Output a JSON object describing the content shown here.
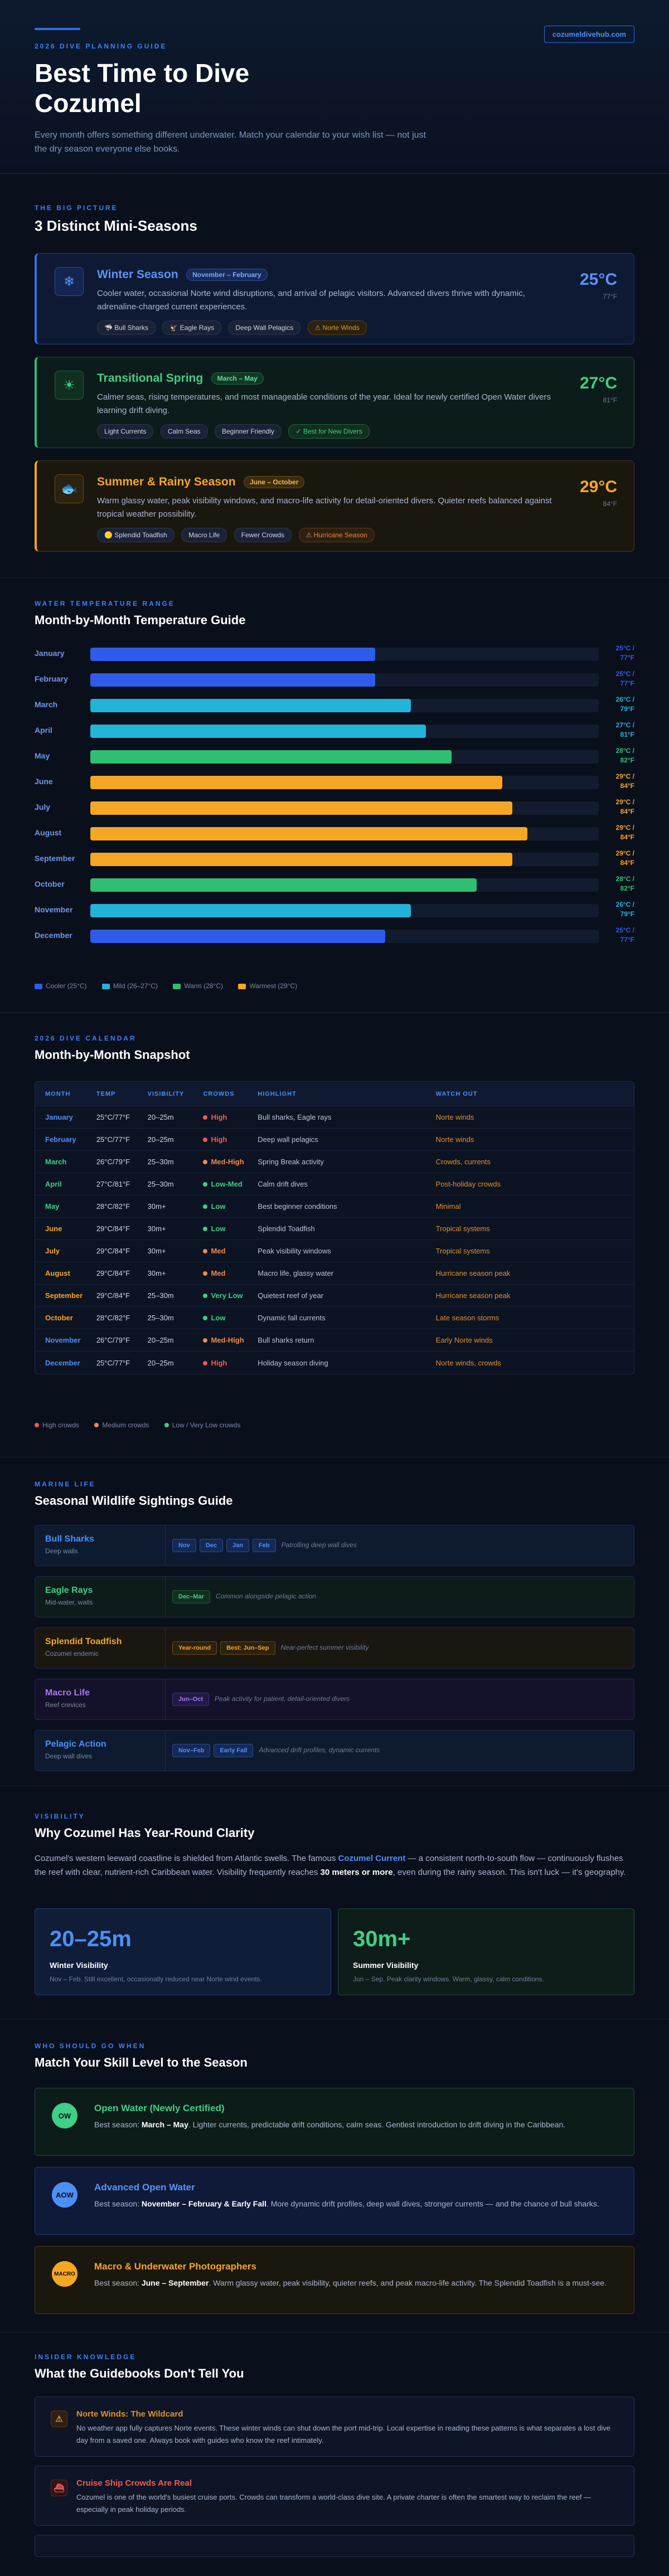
{
  "site": "cozumeldivehub.com",
  "hero": {
    "kicker": "2026 Dive Planning Guide",
    "title_line1": "Best Time to Dive",
    "title_line2": "Cozumel",
    "subtitle": "Every month offers something different underwater. Match your calendar to your wish list — not just the dry season everyone else books."
  },
  "seasons_section": {
    "kicker": "The Big Picture",
    "title": "3 Distinct Mini-Seasons",
    "items": [
      {
        "name": "Winter Season",
        "range": "November – February",
        "desc": "Cooler water, occasional Norte wind disruptions, and arrival of pelagic visitors. Advanced divers thrive with dynamic, adrenaline-charged current experiences.",
        "tags": [
          "🦈 Bull Sharks",
          "🦅 Eagle Rays",
          "Deep Wall Pelagics"
        ],
        "flag": "⚠ Norte Winds",
        "temp_c": "25°C",
        "temp_f": "77°F",
        "icon": "snowflake-icon"
      },
      {
        "name": "Transitional Spring",
        "range": "March – May",
        "desc": "Calmer seas, rising temperatures, and most manageable conditions of the year. Ideal for newly certified Open Water divers learning drift diving.",
        "tags": [
          "Light Currents",
          "Calm Seas",
          "Beginner Friendly"
        ],
        "flag": "✓ Best for New Divers",
        "temp_c": "27°C",
        "temp_f": "81°F",
        "icon": "sun-icon"
      },
      {
        "name": "Summer & Rainy Season",
        "range": "June – October",
        "desc": "Warm glassy water, peak visibility windows, and macro-life activity for detail-oriented divers. Quieter reefs balanced against tropical weather possibility.",
        "tags": [
          "🟡 Splendid Toadfish",
          "Macro Life",
          "Fewer Crowds"
        ],
        "flag": "⚠ Hurricane Season",
        "temp_c": "29°C",
        "temp_f": "84°F",
        "icon": "fish-icon"
      }
    ]
  },
  "temps_section": {
    "kicker": "Water Temperature Range",
    "title": "Month-by-Month Temperature Guide",
    "legend": [
      "Cooler (25°C)",
      "Mild (26–27°C)",
      "Warm (28°C)",
      "Warmest (29°C)"
    ],
    "legend_colors": [
      "#2f5bea",
      "#22b4d8",
      "#2fbf71",
      "#f5a623"
    ]
  },
  "chart_data": {
    "type": "bar",
    "title": "Month-by-Month Temperature Guide",
    "categories": [
      "January",
      "February",
      "March",
      "April",
      "May",
      "June",
      "July",
      "August",
      "September",
      "October",
      "November",
      "December"
    ],
    "values": [
      25,
      25,
      26,
      27,
      28,
      29,
      29,
      29,
      29,
      28,
      26,
      25
    ],
    "values_f": [
      77,
      77,
      79,
      81,
      82,
      84,
      84,
      84,
      84,
      82,
      79,
      77
    ],
    "labels_c": [
      "25°C /",
      "25°C /",
      "26°C /",
      "27°C /",
      "28°C /",
      "29°C /",
      "29°C /",
      "29°C /",
      "29°C /",
      "28°C /",
      "26°C /",
      "25°C /"
    ],
    "labels_f": [
      "77°F",
      "77°F",
      "79°F",
      "81°F",
      "82°F",
      "84°F",
      "84°F",
      "84°F",
      "84°F",
      "82°F",
      "79°F",
      "77°F"
    ],
    "bar_fraction": [
      0.56,
      0.56,
      0.63,
      0.66,
      0.71,
      0.81,
      0.83,
      0.86,
      0.83,
      0.76,
      0.63,
      0.58
    ],
    "colors": [
      "#2f5bea",
      "#2f5bea",
      "#22b4d8",
      "#22b4d8",
      "#2fbf71",
      "#f5a623",
      "#f5a623",
      "#f5a623",
      "#f5a623",
      "#2fbf71",
      "#22b4d8",
      "#2f5bea"
    ],
    "unit": "°C"
  },
  "calendar": {
    "kicker": "2026 Dive Calendar",
    "title": "Month-by-Month Snapshot",
    "headers": [
      "MONTH",
      "TEMP",
      "VISIBILITY",
      "CROWDS",
      "HIGHLIGHT",
      "WATCH OUT"
    ],
    "rows": [
      {
        "month": "January",
        "temp": "25°C/77°F",
        "vis": "20–25m",
        "crowds": "High",
        "highlight": "Bull sharks, Eagle rays",
        "watch": "Norte winds",
        "mcolor": "#4d8ff5",
        "ccolor": "#ef5a5a",
        "wcolor": "#e0902f"
      },
      {
        "month": "February",
        "temp": "25°C/77°F",
        "vis": "20–25m",
        "crowds": "High",
        "highlight": "Deep wall pelagics",
        "watch": "Norte winds",
        "mcolor": "#4d8ff5",
        "ccolor": "#ef5a5a",
        "wcolor": "#e0902f"
      },
      {
        "month": "March",
        "temp": "26°C/79°F",
        "vis": "25–30m",
        "crowds": "Med-High",
        "highlight": "Spring Break activity",
        "watch": "Crowds, currents",
        "mcolor": "#3fcf86",
        "ccolor": "#f08a4b",
        "wcolor": "#e0902f"
      },
      {
        "month": "April",
        "temp": "27°C/81°F",
        "vis": "25–30m",
        "crowds": "Low-Med",
        "highlight": "Calm drift dives",
        "watch": "Post-holiday crowds",
        "mcolor": "#3fcf86",
        "ccolor": "#3fcf86",
        "wcolor": "#e0902f"
      },
      {
        "month": "May",
        "temp": "28°C/82°F",
        "vis": "30m+",
        "crowds": "Low",
        "highlight": "Best beginner conditions",
        "watch": "Minimal",
        "mcolor": "#3fcf86",
        "ccolor": "#3fcf86",
        "wcolor": "#e0902f"
      },
      {
        "month": "June",
        "temp": "29°C/84°F",
        "vis": "30m+",
        "crowds": "Low",
        "highlight": "Splendid Toadfish",
        "watch": "Tropical systems",
        "mcolor": "#f5a623",
        "ccolor": "#3fcf86",
        "wcolor": "#e0902f"
      },
      {
        "month": "July",
        "temp": "29°C/84°F",
        "vis": "30m+",
        "crowds": "Med",
        "highlight": "Peak visibility windows",
        "watch": "Tropical systems",
        "mcolor": "#f5a623",
        "ccolor": "#f08a4b",
        "wcolor": "#e0902f"
      },
      {
        "month": "August",
        "temp": "29°C/84°F",
        "vis": "30m+",
        "crowds": "Med",
        "highlight": "Macro life, glassy water",
        "watch": "Hurricane season peak",
        "mcolor": "#f5a623",
        "ccolor": "#f08a4b",
        "wcolor": "#e0902f"
      },
      {
        "month": "September",
        "temp": "29°C/84°F",
        "vis": "25–30m",
        "crowds": "Very Low",
        "highlight": "Quietest reef of year",
        "watch": "Hurricane season peak",
        "mcolor": "#f5a623",
        "ccolor": "#3fcf86",
        "wcolor": "#e0902f"
      },
      {
        "month": "October",
        "temp": "28°C/82°F",
        "vis": "25–30m",
        "crowds": "Low",
        "highlight": "Dynamic fall currents",
        "watch": "Late season storms",
        "mcolor": "#f5a623",
        "ccolor": "#3fcf86",
        "wcolor": "#e0902f"
      },
      {
        "month": "November",
        "temp": "26°C/79°F",
        "vis": "20–25m",
        "crowds": "Med-High",
        "highlight": "Bull sharks return",
        "watch": "Early Norte winds",
        "mcolor": "#4d8ff5",
        "ccolor": "#f08a4b",
        "wcolor": "#e0902f"
      },
      {
        "month": "December",
        "temp": "25°C/77°F",
        "vis": "20–25m",
        "crowds": "High",
        "highlight": "Holiday season diving",
        "watch": "Norte winds, crowds",
        "mcolor": "#4d8ff5",
        "ccolor": "#ef5a5a",
        "wcolor": "#e0902f"
      }
    ],
    "legend": [
      "High crowds",
      "Medium crowds",
      "Low / Very Low crowds"
    ],
    "legend_colors": [
      "#ef5a5a",
      "#f08a4b",
      "#3fcf86"
    ]
  },
  "wildlife": {
    "kicker": "Marine Life",
    "title": "Seasonal Wildlife Sightings Guide",
    "items": [
      {
        "name": "Bull Sharks",
        "sub": "Deep walls",
        "months": [
          "Nov",
          "Dec",
          "Jan",
          "Feb"
        ],
        "note": "Patrolling deep wall dives",
        "color": "#4d8ff5",
        "bg": "#0e1a30",
        "mbg": "#142a55",
        "mborder": "#2a4a8a"
      },
      {
        "name": "Eagle Rays",
        "sub": "Mid-water, walls",
        "months": [
          "Dec–Mar"
        ],
        "note": "Common alongside pelagic action",
        "color": "#3fcf86",
        "bg": "#0d1b1a",
        "mbg": "#12301f",
        "mborder": "#1f5a36"
      },
      {
        "name": "Splendid Toadfish",
        "sub": "Cozumel endemic",
        "months": [
          "Year-round",
          "Best: Jun–Sep"
        ],
        "note": "Near-perfect summer visibility",
        "color": "#f5a623",
        "bg": "#1a1710",
        "mbg": "#2b220f",
        "mborder": "#6a4c13"
      },
      {
        "name": "Macro Life",
        "sub": "Reef crevices",
        "months": [
          "Jun–Oct"
        ],
        "note": "Peak activity for patient, detail-oriented divers",
        "color": "#a878f0",
        "bg": "#14122a",
        "mbg": "#221a45",
        "mborder": "#41317a"
      },
      {
        "name": "Pelagic Action",
        "sub": "Deep wall dives",
        "months": [
          "Nov–Feb",
          "Early Fall"
        ],
        "note": "Advanced drift profiles, dynamic currents",
        "color": "#4d8ff5",
        "bg": "#0e1a30",
        "mbg": "#142a55",
        "mborder": "#2a4a8a"
      }
    ]
  },
  "visibility": {
    "kicker": "Visibility",
    "title": "Why Cozumel Has Year-Round Clarity",
    "p1": "Cozumel's western leeward coastline is shielded from Atlantic swells. The famous",
    "p_link": "Cozumel Current",
    "p2": "— a consistent north-to-south flow — continuously flushes the reef with clear, nutrient-rich Caribbean water. Visibility frequently reaches",
    "p_bold": "30 meters or more",
    "p3": ", even during the rainy season. This isn't luck — it's geography.",
    "cards": [
      {
        "big": "20–25m",
        "title": "Winter Visibility",
        "sub": "Nov – Feb. Still excellent, occasionally reduced near Norte wind events."
      },
      {
        "big": "30m+",
        "title": "Summer Visibility",
        "sub": "Jun – Sep. Peak clarity windows. Warm, glassy, calm conditions."
      }
    ]
  },
  "skills": {
    "kicker": "Who Should Go When",
    "title": "Match Your Skill Level to the Season",
    "items": [
      {
        "abbr": "OW",
        "title": "Open Water (Newly Certified)",
        "lead": "Best season:",
        "season": "March – May",
        "rest": ". Lighter currents, predictable drift conditions, calm seas. Gentlest introduction to drift diving in the Caribbean."
      },
      {
        "abbr": "AOW",
        "title": "Advanced Open Water",
        "lead": "Best season:",
        "season": "November – February & Early Fall",
        "rest": ". More dynamic drift profiles, deep wall dives, stronger currents — and the chance of bull sharks."
      },
      {
        "abbr": "MACRO",
        "title": "Macro & Underwater Photographers",
        "lead": "Best season:",
        "season": "June – September",
        "rest": ". Warm glassy water, peak visibility, quieter reefs, and peak macro-life activity. The Splendid Toadfish is a must-see."
      }
    ]
  },
  "insider": {
    "kicker": "Insider Knowledge",
    "title": "What the Guidebooks Don't Tell You",
    "items": [
      {
        "title": "Norte Winds: The Wildcard",
        "desc": "No weather app fully captures Norte events. These winter winds can shut down the port mid-trip. Local expertise in reading these patterns is what separates a lost dive day from a saved one. Always book with guides who know the reef intimately.",
        "icon": "warning-icon",
        "glyph": "⚠"
      },
      {
        "title": "Cruise Ship Crowds Are Real",
        "desc": "Cozumel is one of the world's busiest cruise ports. Crowds can transform a world-class dive site. A private charter is often the smartest way to reclaim the reef — especially in peak holiday periods.",
        "icon": "ship-icon",
        "glyph": "⛴"
      }
    ]
  }
}
